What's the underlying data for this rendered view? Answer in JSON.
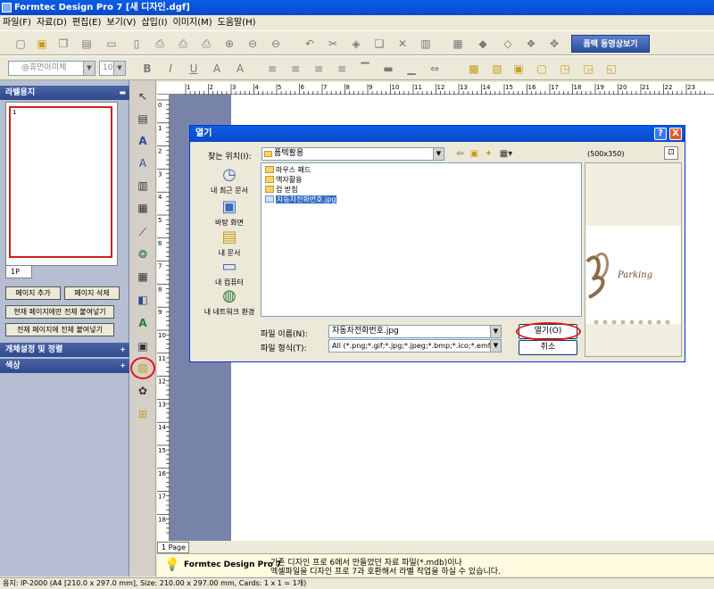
{
  "window": {
    "title": "Formtec Design Pro 7 [새 디자인.dgf]"
  },
  "menu": [
    "파일(F)",
    "자료(D)",
    "편집(E)",
    "보기(V)",
    "삽입(I)",
    "이미지(M)",
    "도움말(H)"
  ],
  "toolbar": {
    "font_name": "@휴먼아미체",
    "font_size": "10",
    "ppt_button": "폼텍 동영상보기"
  },
  "left_panel": {
    "label_paper_header": "라벨용지",
    "thumb_page_number": "1",
    "page_tab": "1P",
    "add_page": "페이지 추가",
    "delete_page": "페이지 삭제",
    "paste_current": "현재 페이지에만 전체 붙여넣기",
    "paste_all": "전체 페이지에 전체 붙여넣기",
    "object_header": "개체설정 및 정렬",
    "color_header": "색상"
  },
  "canvas": {
    "page_tab": "1 Page"
  },
  "message": {
    "title": "Formtec Design Pro 7",
    "line1": "기존 디자인 프로 6에서 만들었던 자료 파일(*.mdb)이나",
    "line2": "엑셀파일을 디자인 프로 7과 호환해서 라벨 작업을 하실 수 있습니다."
  },
  "status": "용지: IP-2000 (A4 [210.0 x 297.0 mm], Size: 210.00 x 297.00 mm, Cards: 1 x 1 = 1개)",
  "dialog": {
    "title": "열기",
    "help_button": "?",
    "close_button": "X",
    "look_in_label": "찾는 위치(I):",
    "look_in_value": "폼텍활용",
    "size_info": "(500x350)",
    "places": [
      "내 최근 문서",
      "바탕 화면",
      "내 문서",
      "내 컴퓨터",
      "내 네트워크 환경"
    ],
    "files": [
      {
        "name": "마우스 패드",
        "type": "folder"
      },
      {
        "name": "액자활용",
        "type": "folder"
      },
      {
        "name": "컵 받침",
        "type": "folder"
      },
      {
        "name": "자동차전화번호.jpg",
        "type": "file",
        "selected": true
      }
    ],
    "preview_text": "Parking",
    "file_name_label": "파일 이름(N):",
    "file_name_value": "자동차전화번호.jpg",
    "file_type_label": "파일 형식(T):",
    "file_type_value": "All (*.png;*.gif;*.jpg;*.jpeg;*.bmp;*.ico;*.emf;*",
    "open_button": "열기(O)",
    "cancel_button": "취소"
  },
  "ruler": {
    "h_ticks": [
      "1",
      "2",
      "3",
      "4",
      "5",
      "6",
      "7",
      "8",
      "9",
      "10",
      "11",
      "12",
      "13",
      "14",
      "15",
      "16",
      "17",
      "18",
      "19",
      "20",
      "21",
      "22",
      "23"
    ],
    "v_ticks": [
      "0",
      "1",
      "2",
      "3",
      "4",
      "5",
      "6",
      "7",
      "8",
      "9",
      "10",
      "11",
      "12",
      "13",
      "14",
      "15",
      "16",
      "17",
      "18",
      "19"
    ]
  },
  "icons": {
    "accent": "#0b49c8",
    "highlight": "#e01818"
  }
}
